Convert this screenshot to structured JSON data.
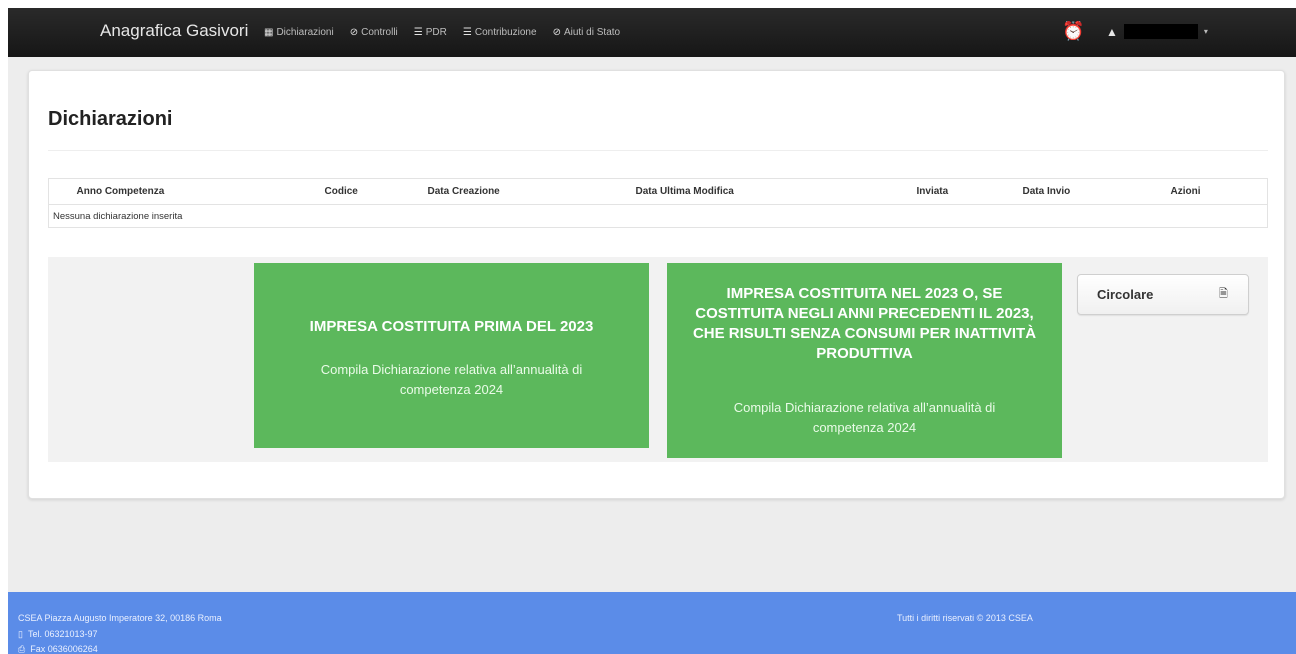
{
  "navbar": {
    "brand": "Anagrafica Gasivori",
    "items": [
      {
        "label": "Dichiarazioni",
        "icon": "list-icon",
        "glyph": "▦"
      },
      {
        "label": "Controlli",
        "icon": "check-circle-icon",
        "glyph": "⊘"
      },
      {
        "label": "PDR",
        "icon": "list-icon",
        "glyph": "☰"
      },
      {
        "label": "Contribuzione",
        "icon": "list-icon",
        "glyph": "☰"
      },
      {
        "label": "Aiuti di Stato",
        "icon": "check-circle-icon",
        "glyph": "⊘"
      }
    ],
    "alarm_glyph": "⏰",
    "user_glyph": "▲",
    "caret_glyph": "▾"
  },
  "page": {
    "title": "Dichiarazioni"
  },
  "table": {
    "columns": [
      "Anno Competenza",
      "Codice",
      "Data Creazione",
      "Data Ultima Modifica",
      "Inviata",
      "Data Invio",
      "Azioni"
    ],
    "empty_message": "Nessuna dichiarazione inserita"
  },
  "cards": [
    {
      "title": "IMPRESA COSTITUITA PRIMA DEL 2023",
      "subtitle": "Compila Dichiarazione relativa all’annualità di competenza 2024"
    },
    {
      "title": "IMPRESA COSTITUITA NEL 2023 O, SE COSTITUITA NEGLI ANNI PRECEDENTI IL 2023, CHE RISULTI SENZA CONSUMI PER INATTIVITÀ PRODUTTIVA",
      "subtitle": "Compila Dichiarazione relativa all’annualità di competenza 2024"
    }
  ],
  "circolare": {
    "label": "Circolare",
    "icon_glyph": "🗎"
  },
  "footer": {
    "address": "CSEA Piazza Augusto Imperatore 32, 00186 Roma",
    "tel": "Tel. 06321013-97",
    "fax": "Fax 0636006264",
    "rights": "Tutti i diritti riservati © 2013 CSEA",
    "tel_glyph": "▯",
    "fax_glyph": "⎙"
  },
  "colors": {
    "navbar": "#1f1f1f",
    "card_green": "#5cb85c",
    "footer_blue": "#5b8ce8"
  }
}
